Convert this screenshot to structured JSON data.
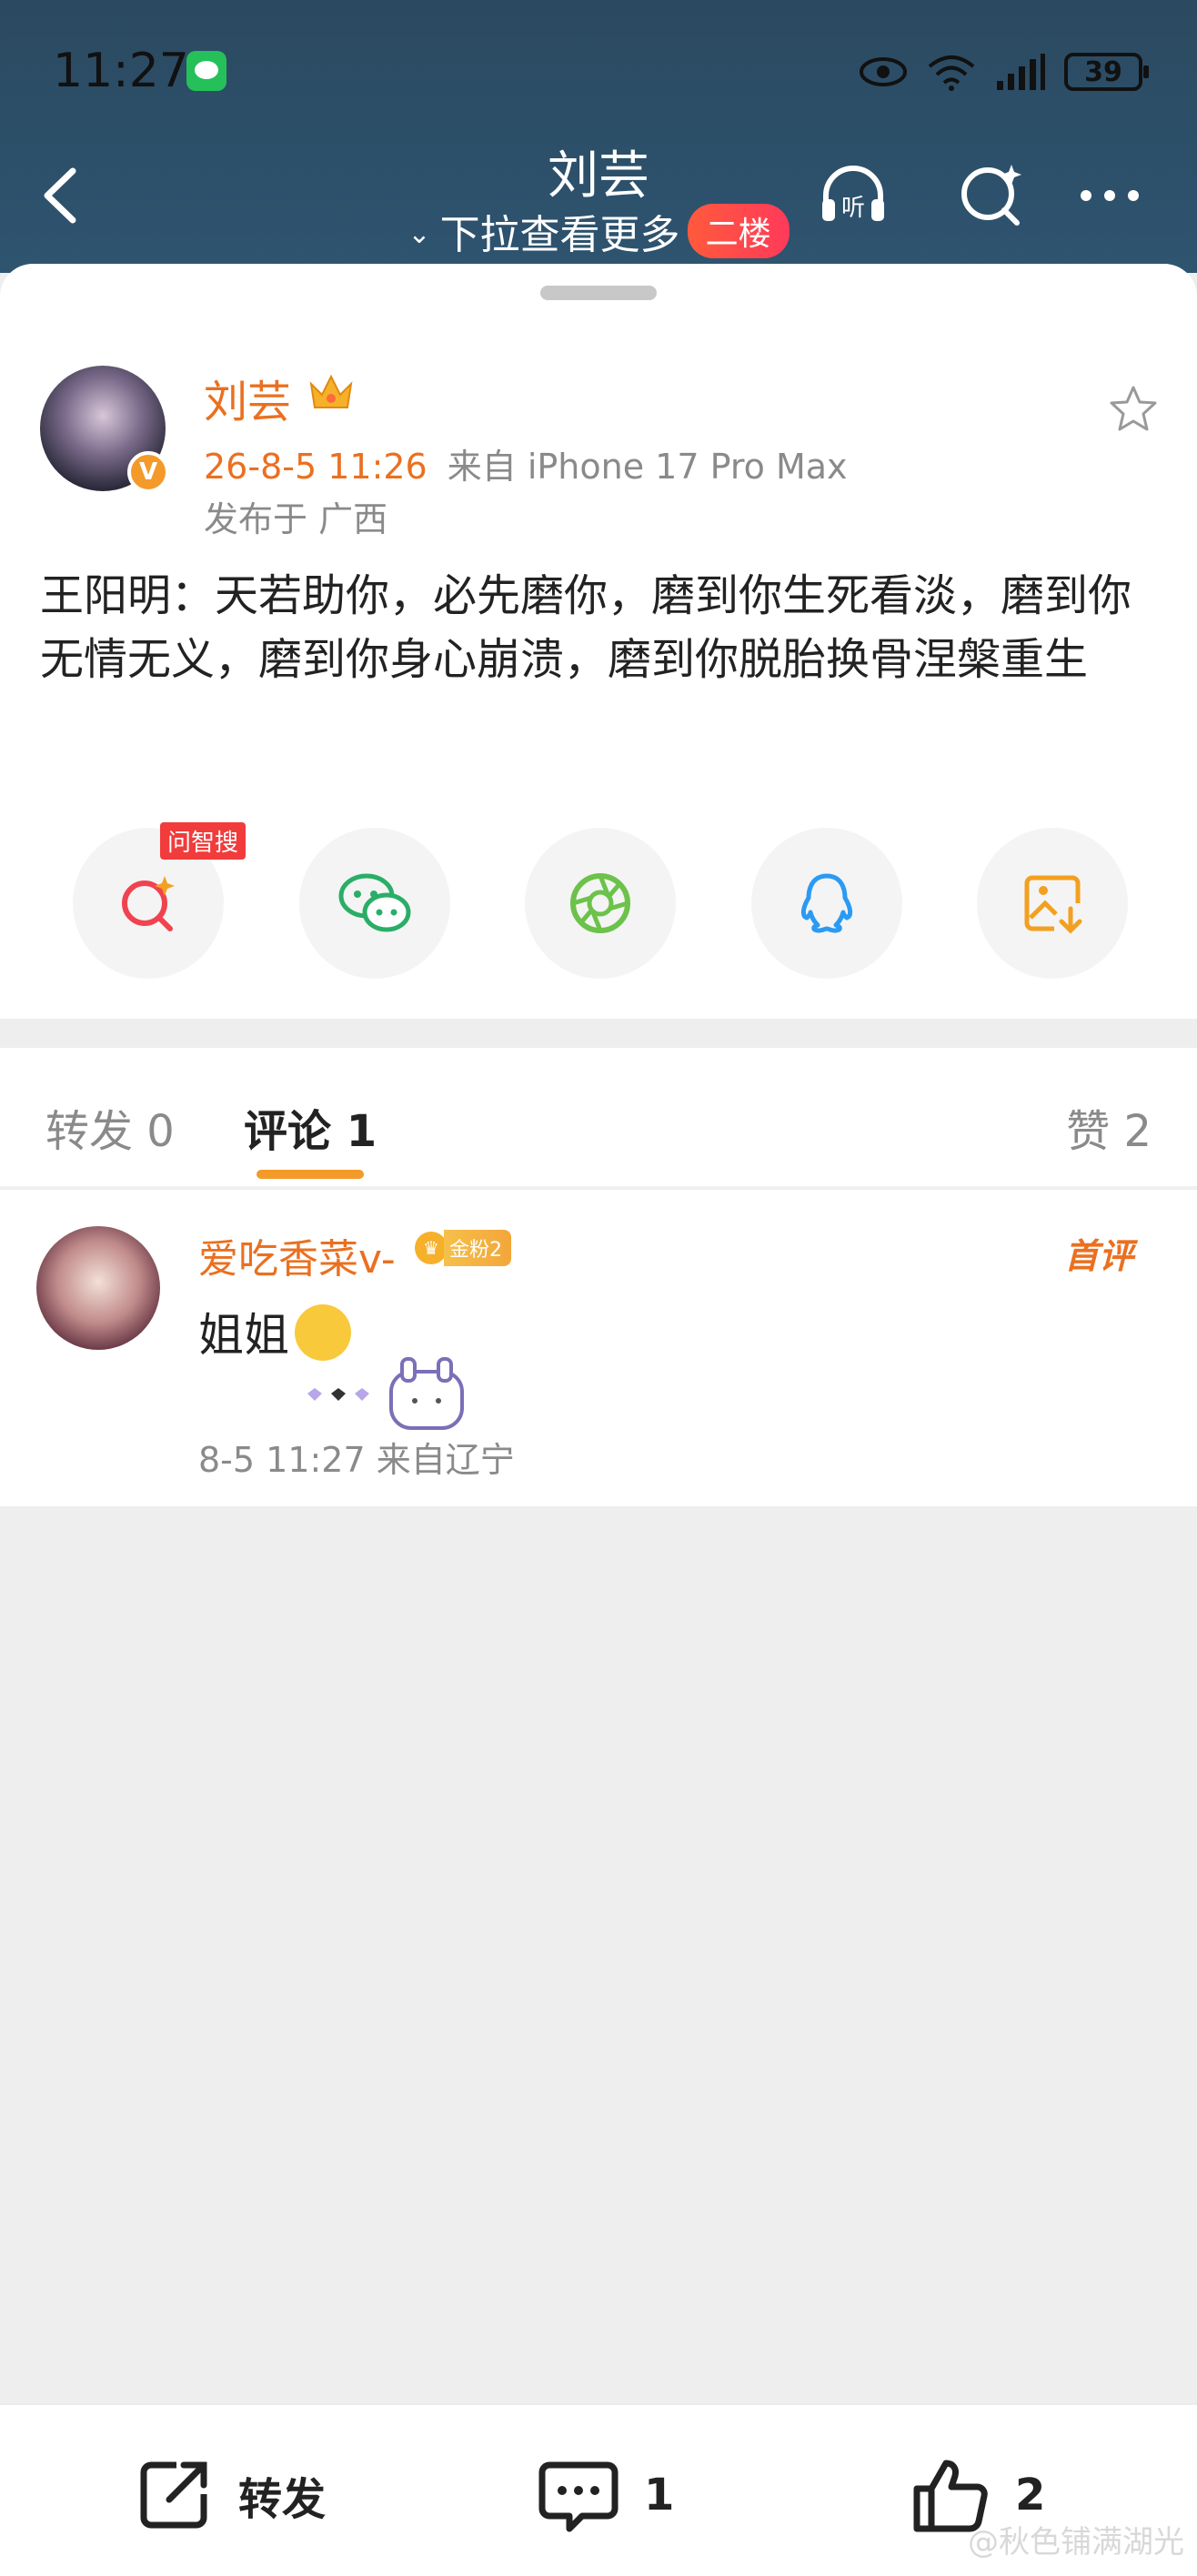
{
  "status_bar": {
    "time": "11:27",
    "battery": "39"
  },
  "nav": {
    "title": "刘芸",
    "subtitle": "下拉查看更多",
    "badge": "二楼",
    "listen_label": "听"
  },
  "post": {
    "author": "刘芸",
    "date": "26-8-5 11:26",
    "source": "来自 iPhone 17 Pro Max",
    "location": "发布于 广西",
    "text": "王阳明：天若助你，必先磨你，磨到你生死看淡，磨到你无情无义，磨到你身心崩溃，磨到你脱胎换骨涅槃重生",
    "verified_mark": "V"
  },
  "share": {
    "ai_search_tag": "问智搜"
  },
  "tabs": {
    "repost": "转发 0",
    "comments": "评论 1",
    "likes": "赞 2"
  },
  "comment": {
    "user": "爱吃香菜v-",
    "fan_level": "金粉2",
    "first_badge": "首评",
    "text": "姐姐",
    "meta": "8-5 11:27  来自辽宁"
  },
  "bottom": {
    "repost_label": "转发",
    "comment_count": "1",
    "like_count": "2"
  },
  "watermark": "@秋色铺满湖光",
  "colors": {
    "accent": "#ea7020",
    "nav_bg": "#2e5470",
    "badge": "#ff4a4a",
    "underline": "#f39a2a"
  }
}
